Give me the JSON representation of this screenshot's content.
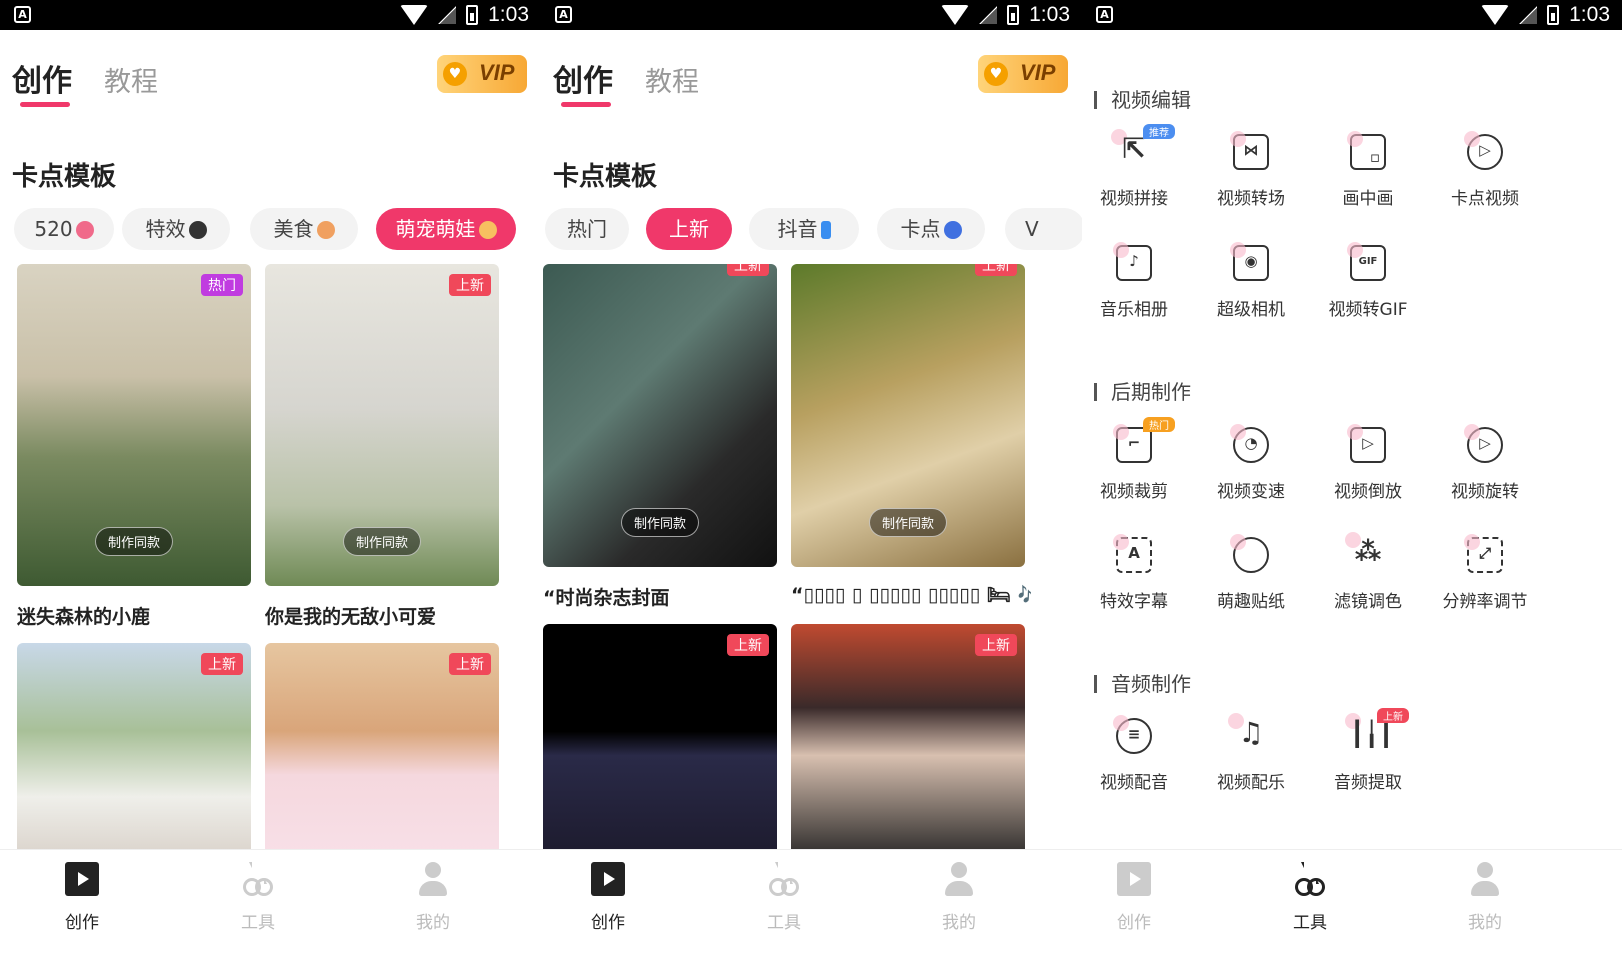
{
  "status": {
    "time": "1:03",
    "notif_icon": "A"
  },
  "header": {
    "tab_create": "创作",
    "tab_tutorial": "教程",
    "vip_label": "VIP"
  },
  "section_title": "卡点模板",
  "panel1": {
    "chips": [
      {
        "label": "520"
      },
      {
        "label": "特效"
      },
      {
        "label": "美食"
      },
      {
        "label": "萌宠萌娃",
        "active": true
      }
    ],
    "cards": [
      {
        "badge": "热门",
        "action": "制作同款",
        "title": "迷失森林的小鹿"
      },
      {
        "badge": "上新",
        "action": "制作同款",
        "title": "你是我的无敌小可爱"
      },
      {
        "badge": "上新"
      },
      {
        "badge": "上新"
      }
    ]
  },
  "panel2": {
    "chips": [
      {
        "label": "热门"
      },
      {
        "label": "上新",
        "active": true
      },
      {
        "label": "抖音"
      },
      {
        "label": "卡点"
      },
      {
        "label": "V"
      }
    ],
    "cards": [
      {
        "badge": "上新",
        "action": "制作同款",
        "title": "“时尚杂志封面"
      },
      {
        "badge": "上新",
        "action": "制作同款",
        "title": "“▯▯▯▯ ▯ ▯▯▯▯▯ ▯▯▯▯▯ 🛏 🎶"
      },
      {
        "badge": "上新"
      },
      {
        "badge": "上新"
      }
    ]
  },
  "tools": {
    "video_edit": {
      "title": "视频编辑",
      "items": [
        {
          "label": "视频拼接",
          "icon": "cursor-icon",
          "badge": "推荐"
        },
        {
          "label": "视频转场",
          "icon": "transition-icon"
        },
        {
          "label": "画中画",
          "icon": "pip-icon"
        },
        {
          "label": "卡点视频",
          "icon": "play-circle-icon"
        },
        {
          "label": "音乐相册",
          "icon": "music-album-icon"
        },
        {
          "label": "超级相机",
          "icon": "camera-icon"
        },
        {
          "label": "视频转GIF",
          "icon": "gif-icon",
          "glyph": "GIF"
        }
      ]
    },
    "post": {
      "title": "后期制作",
      "items": [
        {
          "label": "视频裁剪",
          "icon": "crop-icon",
          "badge": "热门"
        },
        {
          "label": "视频变速",
          "icon": "speed-icon"
        },
        {
          "label": "视频倒放",
          "icon": "reverse-icon"
        },
        {
          "label": "视频旋转",
          "icon": "rotate-icon"
        },
        {
          "label": "特效字幕",
          "icon": "subtitle-icon",
          "glyph": "A"
        },
        {
          "label": "萌趣贴纸",
          "icon": "sticker-icon"
        },
        {
          "label": "滤镜调色",
          "icon": "filter-icon"
        },
        {
          "label": "分辨率调节",
          "icon": "resolution-icon"
        }
      ]
    },
    "audio": {
      "title": "音频制作",
      "items": [
        {
          "label": "视频配音",
          "icon": "microphone-icon"
        },
        {
          "label": "视频配乐",
          "icon": "music-note-icon"
        },
        {
          "label": "音频提取",
          "icon": "waveform-icon",
          "badge": "上新"
        }
      ]
    }
  },
  "nav": {
    "create": "创作",
    "tools": "工具",
    "me": "我的"
  }
}
